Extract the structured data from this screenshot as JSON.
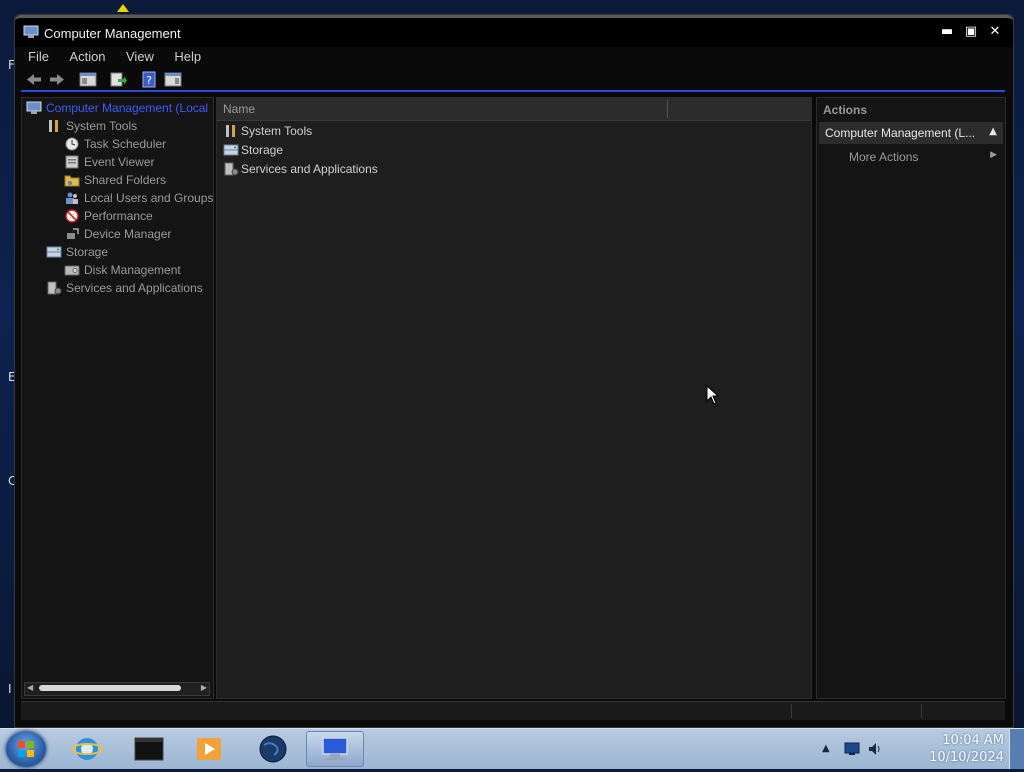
{
  "desktop": {
    "edge_letters": [
      "F",
      "E",
      "C",
      "I"
    ]
  },
  "window": {
    "title": "Computer Management",
    "controls": {
      "minimize": "▬",
      "maximize": "▣",
      "close": "✕"
    }
  },
  "menu": [
    "File",
    "Action",
    "View",
    "Help"
  ],
  "tree": {
    "root": "Computer Management (Local",
    "items": [
      {
        "label": "System Tools",
        "icon": "tools-icon",
        "level": 1
      },
      {
        "label": "Task Scheduler",
        "icon": "clock-icon",
        "level": 2
      },
      {
        "label": "Event Viewer",
        "icon": "event-viewer-icon",
        "level": 2
      },
      {
        "label": "Shared Folders",
        "icon": "shared-folders-icon",
        "level": 2
      },
      {
        "label": "Local Users and Groups",
        "icon": "users-icon",
        "level": 2
      },
      {
        "label": "Performance",
        "icon": "performance-icon",
        "level": 2
      },
      {
        "label": "Device Manager",
        "icon": "device-manager-icon",
        "level": 2
      },
      {
        "label": "Storage",
        "icon": "storage-icon",
        "level": 1
      },
      {
        "label": "Disk Management",
        "icon": "disk-icon",
        "level": 2
      },
      {
        "label": "Services and Applications",
        "icon": "services-icon",
        "level": 1
      }
    ]
  },
  "list": {
    "column_name": "Name",
    "rows": [
      {
        "label": "System Tools",
        "icon": "tools-icon"
      },
      {
        "label": "Storage",
        "icon": "storage-icon"
      },
      {
        "label": "Services and Applications",
        "icon": "services-icon"
      }
    ]
  },
  "actions": {
    "title": "Actions",
    "section": "Computer Management (L...",
    "more": "More Actions"
  },
  "taskbar": {
    "time": "10:04 AM",
    "date": "10/10/2024",
    "apps": [
      "internet-explorer",
      "terminal",
      "media-player",
      "globe",
      "computer-management"
    ]
  },
  "colors": {
    "accent": "#2a4bd8",
    "tree_root": "#3c5cff",
    "pane_bg": "#141414",
    "list_bg": "#1e1e1e",
    "taskbar": "#a9c0da"
  }
}
